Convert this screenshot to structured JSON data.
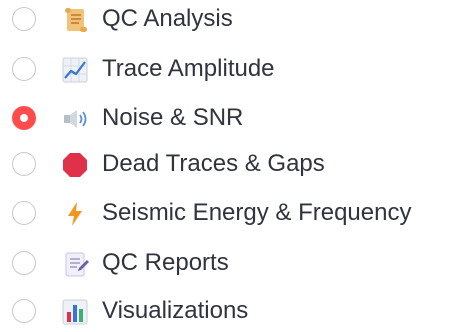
{
  "selected": "noise-snr",
  "accent_color": "#ff4b4b",
  "items": [
    {
      "id": "qc-analysis",
      "label": "QC Analysis",
      "icon": "scroll-icon",
      "selected": false
    },
    {
      "id": "trace-amplitude",
      "label": "Trace Amplitude",
      "icon": "chart-increasing-icon",
      "selected": false
    },
    {
      "id": "noise-snr",
      "label": "Noise & SNR",
      "icon": "speaker-icon",
      "selected": true
    },
    {
      "id": "dead-traces-gaps",
      "label": "Dead Traces & Gaps",
      "icon": "stop-sign-icon",
      "selected": false
    },
    {
      "id": "seismic-energy-frequency",
      "label": "Seismic Energy & Frequency",
      "icon": "lightning-icon",
      "selected": false
    },
    {
      "id": "qc-reports",
      "label": "QC Reports",
      "icon": "memo-icon",
      "selected": false
    },
    {
      "id": "visualizations",
      "label": "Visualizations",
      "icon": "bar-chart-icon",
      "selected": false
    }
  ]
}
